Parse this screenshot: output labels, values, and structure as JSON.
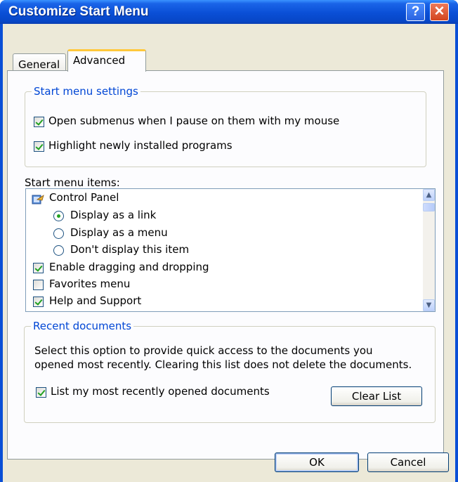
{
  "window": {
    "title": "Customize Start Menu"
  },
  "titlebar": {
    "help_label": "?",
    "close_label": "✕"
  },
  "tabs": [
    {
      "label": "General"
    },
    {
      "label": "Advanced"
    }
  ],
  "start_menu_settings": {
    "legend": "Start menu settings",
    "options": [
      {
        "label": "Open submenus when I pause on them with my mouse",
        "checked": true
      },
      {
        "label": "Highlight newly installed programs",
        "checked": true
      }
    ]
  },
  "start_menu_items": {
    "label": "Start menu items:",
    "items": [
      {
        "label": "Control Panel",
        "type": "heading",
        "icon": "control-panel-icon"
      },
      {
        "label": "Display as a link",
        "type": "radio",
        "checked": true
      },
      {
        "label": "Display as a menu",
        "type": "radio",
        "checked": false
      },
      {
        "label": "Don't display this item",
        "type": "radio",
        "checked": false
      },
      {
        "label": "Enable dragging and dropping",
        "type": "checkbox",
        "checked": true
      },
      {
        "label": "Favorites menu",
        "type": "checkbox",
        "checked": false
      },
      {
        "label": "Help and Support",
        "type": "checkbox",
        "checked": true
      }
    ]
  },
  "recent_documents": {
    "legend": "Recent documents",
    "description_line1": "Select this option to provide quick access to the documents you",
    "description_line2": "opened most recently.  Clearing this list does not delete the documents.",
    "option_label": "List my most recently opened documents",
    "option_checked": true,
    "clear_button": "Clear List"
  },
  "footer": {
    "ok": "OK",
    "cancel": "Cancel"
  }
}
